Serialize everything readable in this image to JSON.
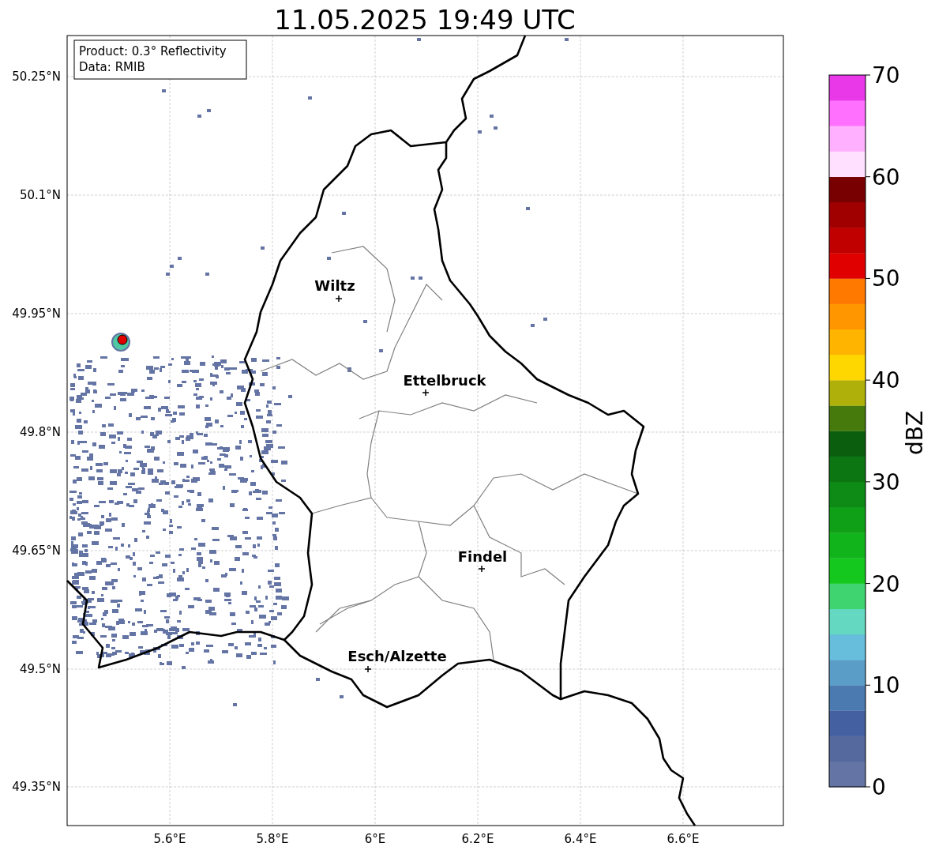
{
  "title": "11.05.2025 19:49 UTC",
  "info_box": [
    "Product: 0.3° Reflectivity",
    "Data: RMIB"
  ],
  "map": {
    "yticks": [
      "50.25°N",
      "50.1°N",
      "49.95°N",
      "49.8°N",
      "49.65°N",
      "49.5°N",
      "49.35°N"
    ],
    "xticks": [
      "5.6°E",
      "5.8°E",
      "6°E",
      "6.2°E",
      "6.4°E",
      "6.6°E"
    ],
    "cities": [
      {
        "name": "Wiltz"
      },
      {
        "name": "Ettelbruck"
      },
      {
        "name": "Findel"
      },
      {
        "name": "Esch/Alzette"
      }
    ]
  },
  "colorbar": {
    "label": "dBZ",
    "ticks": [
      "70",
      "60",
      "50",
      "40",
      "30",
      "20",
      "10",
      "0"
    ],
    "bins": [
      {
        "color": "#6474a4"
      },
      {
        "color": "#56699e"
      },
      {
        "color": "#4560a0"
      },
      {
        "color": "#4a7ab0"
      },
      {
        "color": "#5a9ec8"
      },
      {
        "color": "#66bedc"
      },
      {
        "color": "#64d8c0"
      },
      {
        "color": "#40d470"
      },
      {
        "color": "#14c81e"
      },
      {
        "color": "#12b41c"
      },
      {
        "color": "#10a018"
      },
      {
        "color": "#0e8a16"
      },
      {
        "color": "#0c7612"
      },
      {
        "color": "#0a5e0e"
      },
      {
        "color": "#467a0c"
      },
      {
        "color": "#b0b00a"
      },
      {
        "color": "#ffd700"
      },
      {
        "color": "#ffb400"
      },
      {
        "color": "#ff9600"
      },
      {
        "color": "#ff7800"
      },
      {
        "color": "#e00000"
      },
      {
        "color": "#c00000"
      },
      {
        "color": "#a00000"
      },
      {
        "color": "#780000"
      },
      {
        "color": "#ffe0ff"
      },
      {
        "color": "#ffb0ff"
      },
      {
        "color": "#ff70ff"
      },
      {
        "color": "#e838e8"
      }
    ]
  }
}
